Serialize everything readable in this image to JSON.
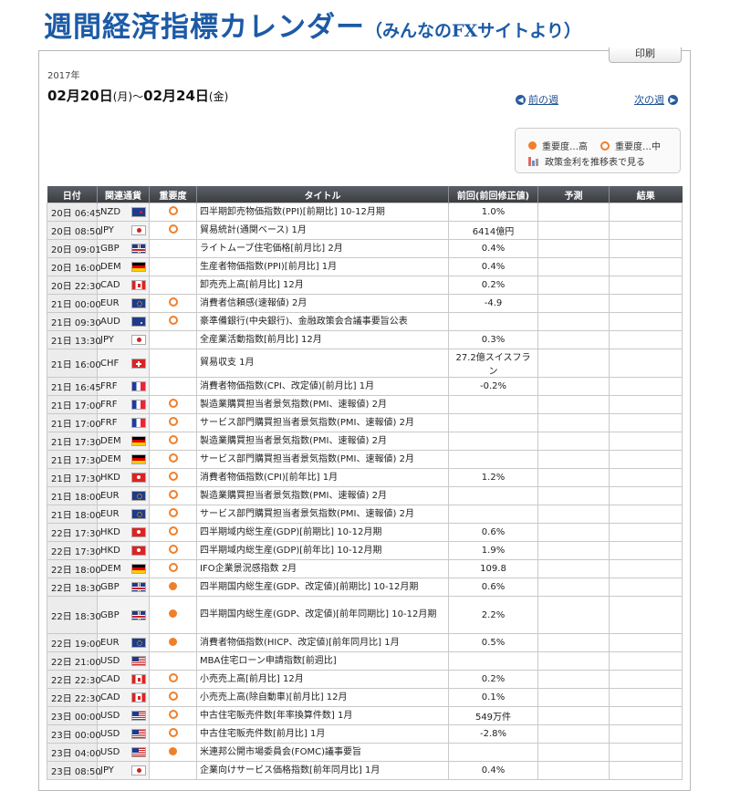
{
  "header": {
    "title_main": "週間経済指標カレンダー",
    "title_sub": "（みんなのFXサイトより）"
  },
  "panel": {
    "print_label": "印刷",
    "year": "2017年",
    "range": {
      "start_date": "02月20日",
      "start_dow": "(月)",
      "separator": "〜",
      "end_date": "02月24日",
      "end_dow": "(金)"
    },
    "prev_week": "前の週",
    "next_week": "次の週"
  },
  "legend": {
    "high": "重要度…高",
    "mid": "重要度…中",
    "policy_rate_link": "政策金利を推移表で見る"
  },
  "table": {
    "headers": [
      "日付",
      "関連通貨",
      "重要度",
      "タイトル",
      "前回(前回修正値)",
      "予測",
      "結果"
    ],
    "rows": [
      {
        "date": "20日 06:45",
        "currency": "NZD",
        "flag": "f-nzd",
        "importance": "mid",
        "title": "四半期卸売物価指数(PPI)[前期比] 10-12月期",
        "previous": "1.0%",
        "forecast": "",
        "result": ""
      },
      {
        "date": "20日 08:50",
        "currency": "JPY",
        "flag": "f-jpy",
        "importance": "mid",
        "title": "貿易統計(通関ベース) 1月",
        "previous": "6414億円",
        "forecast": "",
        "result": ""
      },
      {
        "date": "20日 09:01",
        "currency": "GBP",
        "flag": "f-gbp",
        "importance": "",
        "title": "ライトムーブ住宅価格[前月比] 2月",
        "previous": "0.4%",
        "forecast": "",
        "result": ""
      },
      {
        "date": "20日 16:00",
        "currency": "DEM",
        "flag": "f-dem",
        "importance": "",
        "title": "生産者物価指数(PPI)[前月比] 1月",
        "previous": "0.4%",
        "forecast": "",
        "result": ""
      },
      {
        "date": "20日 22:30",
        "currency": "CAD",
        "flag": "f-cad",
        "importance": "",
        "title": "卸売売上高[前月比] 12月",
        "previous": "0.2%",
        "forecast": "",
        "result": ""
      },
      {
        "date": "21日 00:00",
        "currency": "EUR",
        "flag": "f-eur",
        "importance": "mid",
        "title": "消費者信頼感(速報値) 2月",
        "previous": "-4.9",
        "forecast": "",
        "result": ""
      },
      {
        "date": "21日 09:30",
        "currency": "AUD",
        "flag": "f-aud",
        "importance": "mid",
        "title": "豪準備銀行(中央銀行)、金融政策会合議事要旨公表",
        "previous": "",
        "forecast": "",
        "result": ""
      },
      {
        "date": "21日 13:30",
        "currency": "JPY",
        "flag": "f-jpy",
        "importance": "",
        "title": "全産業活動指数[前月比] 12月",
        "previous": "0.3%",
        "forecast": "",
        "result": ""
      },
      {
        "date": "21日 16:00",
        "currency": "CHF",
        "flag": "f-chf",
        "importance": "",
        "title": "貿易収支 1月",
        "previous": "27.2億スイスフラン",
        "forecast": "",
        "result": ""
      },
      {
        "date": "21日 16:45",
        "currency": "FRF",
        "flag": "f-frf",
        "importance": "",
        "title": "消費者物価指数(CPI、改定値)[前月比] 1月",
        "previous": "-0.2%",
        "forecast": "",
        "result": ""
      },
      {
        "date": "21日 17:00",
        "currency": "FRF",
        "flag": "f-frf",
        "importance": "mid",
        "title": "製造業購買担当者景気指数(PMI、速報値) 2月",
        "previous": "",
        "forecast": "",
        "result": ""
      },
      {
        "date": "21日 17:00",
        "currency": "FRF",
        "flag": "f-frf",
        "importance": "mid",
        "title": "サービス部門購買担当者景気指数(PMI、速報値) 2月",
        "previous": "",
        "forecast": "",
        "result": ""
      },
      {
        "date": "21日 17:30",
        "currency": "DEM",
        "flag": "f-dem",
        "importance": "mid",
        "title": "製造業購買担当者景気指数(PMI、速報値) 2月",
        "previous": "",
        "forecast": "",
        "result": ""
      },
      {
        "date": "21日 17:30",
        "currency": "DEM",
        "flag": "f-dem",
        "importance": "mid",
        "title": "サービス部門購買担当者景気指数(PMI、速報値) 2月",
        "previous": "",
        "forecast": "",
        "result": ""
      },
      {
        "date": "21日 17:30",
        "currency": "HKD",
        "flag": "f-hkd",
        "importance": "mid",
        "title": "消費者物価指数(CPI)[前年比] 1月",
        "previous": "1.2%",
        "forecast": "",
        "result": ""
      },
      {
        "date": "21日 18:00",
        "currency": "EUR",
        "flag": "f-eur",
        "importance": "mid",
        "title": "製造業購買担当者景気指数(PMI、速報値) 2月",
        "previous": "",
        "forecast": "",
        "result": ""
      },
      {
        "date": "21日 18:00",
        "currency": "EUR",
        "flag": "f-eur",
        "importance": "mid",
        "title": "サービス部門購買担当者景気指数(PMI、速報値) 2月",
        "previous": "",
        "forecast": "",
        "result": ""
      },
      {
        "date": "22日 17:30",
        "currency": "HKD",
        "flag": "f-hkd",
        "importance": "mid",
        "title": "四半期域内総生産(GDP)[前期比] 10-12月期",
        "previous": "0.6%",
        "forecast": "",
        "result": ""
      },
      {
        "date": "22日 17:30",
        "currency": "HKD",
        "flag": "f-hkd",
        "importance": "mid",
        "title": "四半期域内総生産(GDP)[前年比] 10-12月期",
        "previous": "1.9%",
        "forecast": "",
        "result": ""
      },
      {
        "date": "22日 18:00",
        "currency": "DEM",
        "flag": "f-dem",
        "importance": "mid",
        "title": "IFO企業景況感指数 2月",
        "previous": "109.8",
        "forecast": "",
        "result": ""
      },
      {
        "date": "22日 18:30",
        "currency": "GBP",
        "flag": "f-gbp",
        "importance": "high",
        "title": "四半期国内総生産(GDP、改定値)[前期比] 10-12月期",
        "previous": "0.6%",
        "forecast": "",
        "result": ""
      },
      {
        "date": "22日 18:30",
        "currency": "GBP",
        "flag": "f-gbp",
        "importance": "high",
        "title": "四半期国内総生産(GDP、改定値)[前年同期比] 10-12月期",
        "previous": "2.2%",
        "forecast": "",
        "result": "",
        "tall": true
      },
      {
        "date": "22日 19:00",
        "currency": "EUR",
        "flag": "f-eur",
        "importance": "high",
        "title": "消費者物価指数(HICP、改定値)[前年同月比] 1月",
        "previous": "0.5%",
        "forecast": "",
        "result": ""
      },
      {
        "date": "22日 21:00",
        "currency": "USD",
        "flag": "f-usd",
        "importance": "",
        "title": "MBA住宅ローン申請指数[前週比]",
        "previous": "",
        "forecast": "",
        "result": ""
      },
      {
        "date": "22日 22:30",
        "currency": "CAD",
        "flag": "f-cad",
        "importance": "mid",
        "title": "小売売上高[前月比] 12月",
        "previous": "0.2%",
        "forecast": "",
        "result": ""
      },
      {
        "date": "22日 22:30",
        "currency": "CAD",
        "flag": "f-cad",
        "importance": "mid",
        "title": "小売売上高(除自動車)[前月比] 12月",
        "previous": "0.1%",
        "forecast": "",
        "result": ""
      },
      {
        "date": "23日 00:00",
        "currency": "USD",
        "flag": "f-usd",
        "importance": "mid",
        "title": "中古住宅販売件数[年率換算件数] 1月",
        "previous": "549万件",
        "forecast": "",
        "result": ""
      },
      {
        "date": "23日 00:00",
        "currency": "USD",
        "flag": "f-usd",
        "importance": "mid",
        "title": "中古住宅販売件数[前月比] 1月",
        "previous": "-2.8%",
        "forecast": "",
        "result": ""
      },
      {
        "date": "23日 04:00",
        "currency": "USD",
        "flag": "f-usd",
        "importance": "high",
        "title": "米連邦公開市場委員会(FOMC)議事要旨",
        "previous": "",
        "forecast": "",
        "result": ""
      },
      {
        "date": "23日 08:50",
        "currency": "JPY",
        "flag": "f-jpy",
        "importance": "",
        "title": "企業向けサービス価格指数[前年同月比] 1月",
        "previous": "0.4%",
        "forecast": "",
        "result": ""
      }
    ]
  }
}
